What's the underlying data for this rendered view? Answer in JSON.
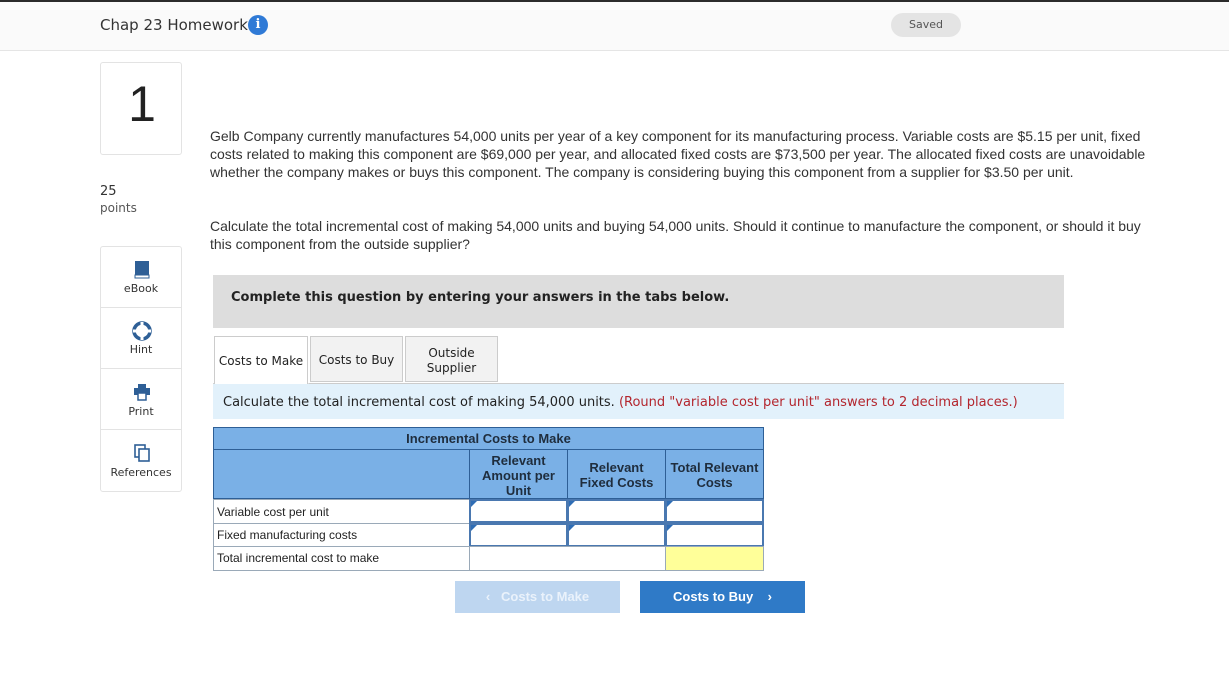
{
  "header": {
    "title": "Chap 23 Homework",
    "info_glyph": "i",
    "saved_label": "Saved"
  },
  "question": {
    "number": "1",
    "points_value": "25",
    "points_label": "points",
    "text_p1": "Gelb Company currently manufactures 54,000 units per year of a key component for its manufacturing process. Variable costs are $5.15 per unit, fixed costs related to making this component are $69,000 per year, and allocated fixed costs are $73,500 per year. The allocated fixed costs are unavoidable whether the company makes or buys this component. The company is considering buying this component from a supplier for $3.50 per unit.",
    "text_p2": "Calculate the total incremental cost of making 54,000 units and buying 54,000 units. Should it continue to manufacture the component, or should it buy this component from the outside supplier?"
  },
  "tools": [
    {
      "label": "eBook",
      "icon": "book-icon"
    },
    {
      "label": "Hint",
      "icon": "lifebuoy-icon"
    },
    {
      "label": "Print",
      "icon": "printer-icon"
    },
    {
      "label": "References",
      "icon": "documents-icon"
    }
  ],
  "instruction": "Complete this question by entering your answers in the tabs below.",
  "tabs": {
    "tab1": "Costs to Make",
    "tab2": "Costs to Buy",
    "tab3_line1": "Outside",
    "tab3_line2": "Supplier"
  },
  "calc": {
    "text": "Calculate the total incremental cost of making 54,000 units.",
    "note": "(Round \"variable cost per unit\" answers to 2 decimal places.)"
  },
  "table": {
    "title": "Incremental Costs to Make",
    "col1_l1": "Relevant",
    "col1_l2": "Amount per",
    "col1_l3": "Unit",
    "col2_l1": "Relevant",
    "col2_l2": "Fixed Costs",
    "col3_l1": "Total Relevant",
    "col3_l2": "Costs",
    "rows": [
      {
        "label": "Variable cost per unit"
      },
      {
        "label": "Fixed manufacturing costs"
      },
      {
        "label": "Total incremental cost to make"
      }
    ]
  },
  "nav": {
    "prev_label": "Costs to Make",
    "next_label": "Costs to Buy",
    "prev_glyph": "‹",
    "next_glyph": "›"
  },
  "colors": {
    "accent": "#2f7ac7",
    "table_header": "#7ab0e6",
    "total_cell": "#ffff99",
    "note_red": "#b3262e"
  }
}
